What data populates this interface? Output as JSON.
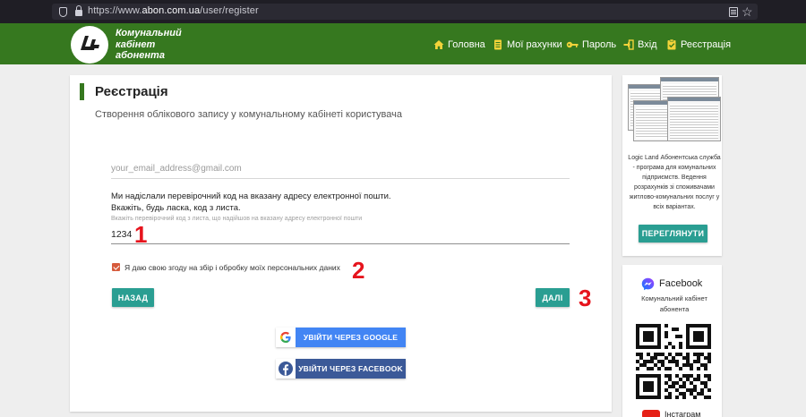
{
  "browser": {
    "url_prefix": "https://www.",
    "url_domain": "abon.com.ua",
    "url_path": "/user/register"
  },
  "header": {
    "logo_lines": [
      "Комунальний",
      "кабінет",
      "абонента"
    ],
    "nav": [
      {
        "label": "Головна",
        "icon": "home-icon"
      },
      {
        "label": "Мої рахунки",
        "icon": "receipt-icon"
      },
      {
        "label": "Пароль",
        "icon": "key-icon"
      },
      {
        "label": "Вхід",
        "icon": "login-icon"
      },
      {
        "label": "Реєстрація",
        "icon": "clipboard-check-icon"
      }
    ]
  },
  "form": {
    "title": "Реєстрація",
    "subtitle": "Створення облікового запису у комунальному кабінеті користувача",
    "email_placeholder": "your_email_address@gmail.com",
    "message_line1": "Ми надіслали перевірочний код на вказану адресу електронної пошти.",
    "message_line2": "Вкажіть, будь ласка, код з листа.",
    "code_hint": "Вкажіть перевірочний код з листа, що надійшов на вказану адресу електронної пошти",
    "code_value": "1234",
    "consent_checked": true,
    "consent_label": "Я даю свою згоду на збір і обробку моїх персональних даних",
    "back_button": "Назад",
    "next_button": "Далі",
    "google_button": "Увійти через Google",
    "facebook_button": "Увійти через Facebook"
  },
  "annotations": [
    "1",
    "2",
    "3"
  ],
  "sidebar": {
    "description": "Logic Land Абонентська служба - програма для комунальних підприємств. Ведення розрахунків зі споживачами житлово-комунальних послуг у всіх варіантах.",
    "view_button": "Переглянути",
    "facebook_title": "Facebook",
    "facebook_sub": "Комунальний кабінет абонента",
    "youtube_title": "Інстаграм"
  },
  "colors": {
    "header_green": "#36781f",
    "teal_button": "#2a9e92",
    "google_blue": "#4285f4",
    "facebook_blue": "#3b5998",
    "annotation_red": "#e6141d",
    "checkbox": "#d65b3c"
  }
}
